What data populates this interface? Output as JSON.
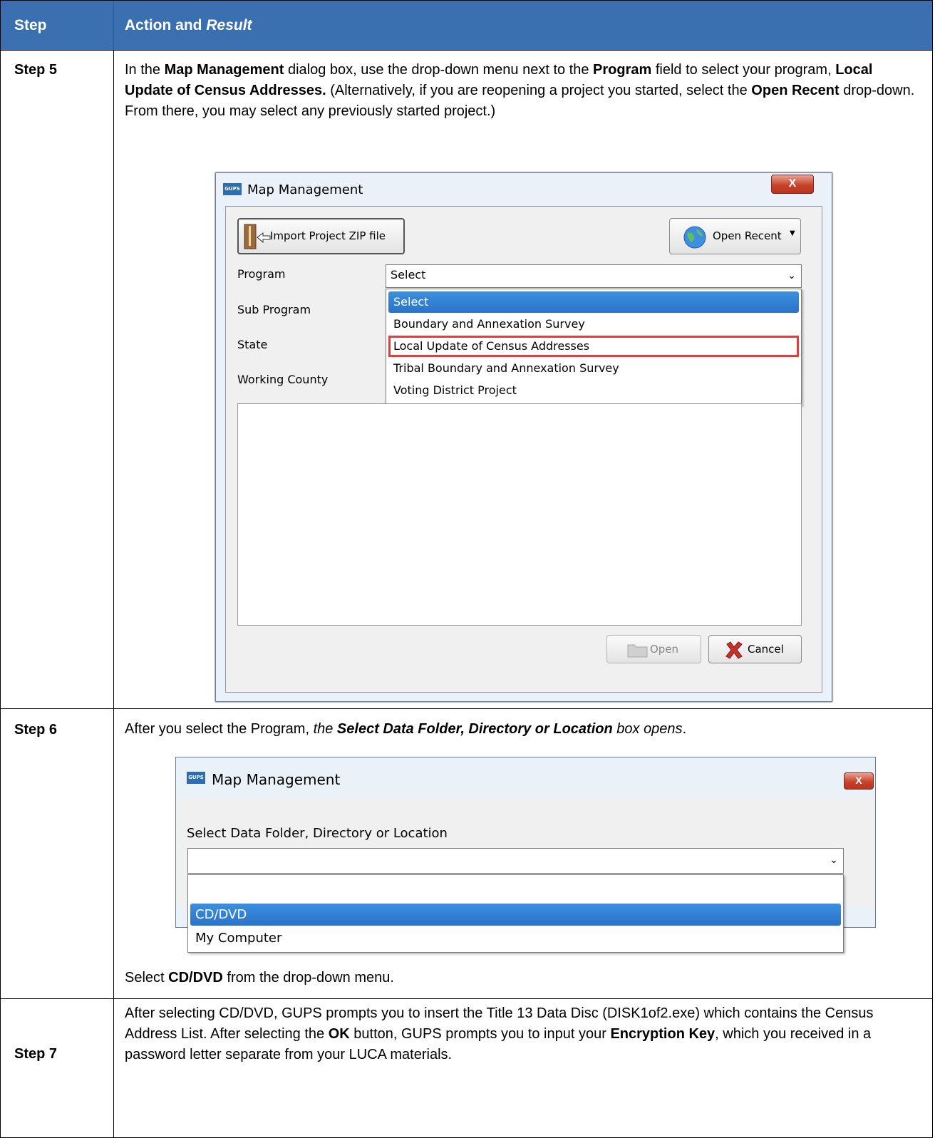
{
  "table": {
    "header": {
      "step_col": "Step",
      "action_col_prefix": "Action and ",
      "action_col_italic": "Result"
    },
    "rows": [
      {
        "step": "Step 5",
        "text": [
          {
            "t": "In the ",
            "s": "n"
          },
          {
            "t": "Map Management",
            "s": "b"
          },
          {
            "t": " dialog box, use the drop-down menu next to the ",
            "s": "n"
          },
          {
            "t": "Program",
            "s": "b"
          },
          {
            "t": " field to select your program, ",
            "s": "n"
          },
          {
            "t": "Local Update of Census Addresses.",
            "s": "b"
          },
          {
            "t": " (Alternatively, if you are reopening a project you started, select the ",
            "s": "n"
          },
          {
            "t": "Open Recent",
            "s": "b"
          },
          {
            "t": " drop-down. From there, you may select any previously started project.)",
            "s": "n"
          }
        ]
      },
      {
        "step": "Step 6",
        "text": [
          {
            "t": "After you select the Program, ",
            "s": "n"
          },
          {
            "t": "the ",
            "s": "i"
          },
          {
            "t": "Select Data Folder, Directory or Location",
            "s": "bi"
          },
          {
            "t": " box opens",
            "s": "i"
          },
          {
            "t": ".",
            "s": "n"
          }
        ],
        "after": [
          {
            "t": "Select ",
            "s": "n"
          },
          {
            "t": "CD/DVD",
            "s": "b"
          },
          {
            "t": " from the drop-down menu.",
            "s": "n"
          }
        ]
      },
      {
        "step": "Step 7",
        "text": [
          {
            "t": "After selecting CD/DVD, GUPS prompts you to insert the Title 13 Data Disc (DISK1of2.exe) which contains the Census Address List. After selecting the ",
            "s": "n"
          },
          {
            "t": "OK",
            "s": "b"
          },
          {
            "t": " button, GUPS prompts you to input your ",
            "s": "n"
          },
          {
            "t": "Encryption Key",
            "s": "b"
          },
          {
            "t": ", which you received in a password letter separate from your LUCA materials.",
            "s": "n"
          }
        ]
      }
    ]
  },
  "dialog1": {
    "title": "Map Management",
    "app_icon": "GUPS",
    "close_glyph": "X",
    "import_button": "Import Project ZIP file",
    "open_recent_button": "Open Recent",
    "labels": {
      "program": "Program",
      "sub_program": "Sub Program",
      "state": "State",
      "working_county": "Working County"
    },
    "program_value": "Select",
    "program_options": [
      "Select",
      "Boundary and Annexation Survey",
      "Local Update of Census Addresses",
      "Tribal Boundary and Annexation Survey",
      "Voting District Project"
    ],
    "selected_option": "Select",
    "highlighted_option": "Local Update of Census Addresses",
    "open_button": "Open",
    "cancel_button": "Cancel"
  },
  "dialog2": {
    "title": "Map Management",
    "app_icon": "GUPS",
    "close_glyph": "X",
    "prompt": "Select Data Folder, Directory or Location",
    "value": "",
    "options": [
      "CD/DVD",
      "My Computer"
    ],
    "selected_option": "CD/DVD"
  },
  "colors": {
    "header_bg": "#3a6fb0",
    "selection": "#2b73c8",
    "highlight_box": "#e53c3c",
    "close_button": "#c7432a"
  }
}
